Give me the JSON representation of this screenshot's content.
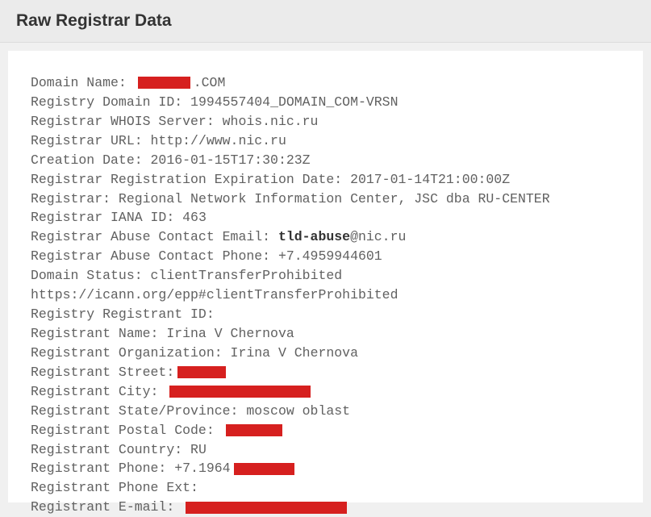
{
  "header": {
    "title": "Raw Registrar Data"
  },
  "whois": {
    "domain_name_label": "Domain Name: ",
    "domain_name_suffix": ".COM",
    "domain_name_redact_width": 65,
    "registry_domain_id_label": "Registry Domain ID: ",
    "registry_domain_id_value": "1994557404_DOMAIN_COM-VRSN",
    "registrar_whois_server_label": "Registrar WHOIS Server: ",
    "registrar_whois_server_value": "whois.nic.ru",
    "registrar_url_label": "Registrar URL: ",
    "registrar_url_value": "http://www.nic.ru",
    "creation_date_label": "Creation Date: ",
    "creation_date_value": "2016-01-15T17:30:23Z",
    "expiration_label": "Registrar Registration Expiration Date: ",
    "expiration_value": "2017-01-14T21:00:00Z",
    "registrar_label": "Registrar: ",
    "registrar_value": "Regional Network Information Center, JSC dba RU-CENTER",
    "iana_id_label": "Registrar IANA ID: ",
    "iana_id_value": "463",
    "abuse_email_label": "Registrar Abuse Contact Email: ",
    "abuse_email_bold": "tld-abuse",
    "abuse_email_rest": "@nic.ru",
    "abuse_phone_label": "Registrar Abuse Contact Phone: ",
    "abuse_phone_value": "+7.4959944601",
    "domain_status_label": "Domain Status: ",
    "domain_status_value": "clientTransferProhibited",
    "icann_url": "https://icann.org/epp#clientTransferProhibited",
    "registry_registrant_id_label": "Registry Registrant ID:",
    "registrant_name_label": "Registrant Name: ",
    "registrant_name_value": "Irina V Chernova",
    "registrant_org_label": "Registrant Organization: ",
    "registrant_org_value": "Irina V Chernova",
    "registrant_street_label": "Registrant Street:",
    "registrant_street_redact_width": 60,
    "registrant_city_label": "Registrant City: ",
    "registrant_city_redact_width": 175,
    "registrant_state_label": "Registrant State/Province: ",
    "registrant_state_value": "moscow oblast",
    "registrant_postal_label": "Registrant Postal Code: ",
    "registrant_postal_redact_width": 70,
    "registrant_country_label": "Registrant Country: ",
    "registrant_country_value": "RU",
    "registrant_phone_label": "Registrant Phone: ",
    "registrant_phone_prefix": "+7.1964",
    "registrant_phone_redact_width": 75,
    "registrant_phone_ext_label": "Registrant Phone Ext:",
    "registrant_email_label": "Registrant E-mail: ",
    "registrant_email_redact_width": 200
  }
}
